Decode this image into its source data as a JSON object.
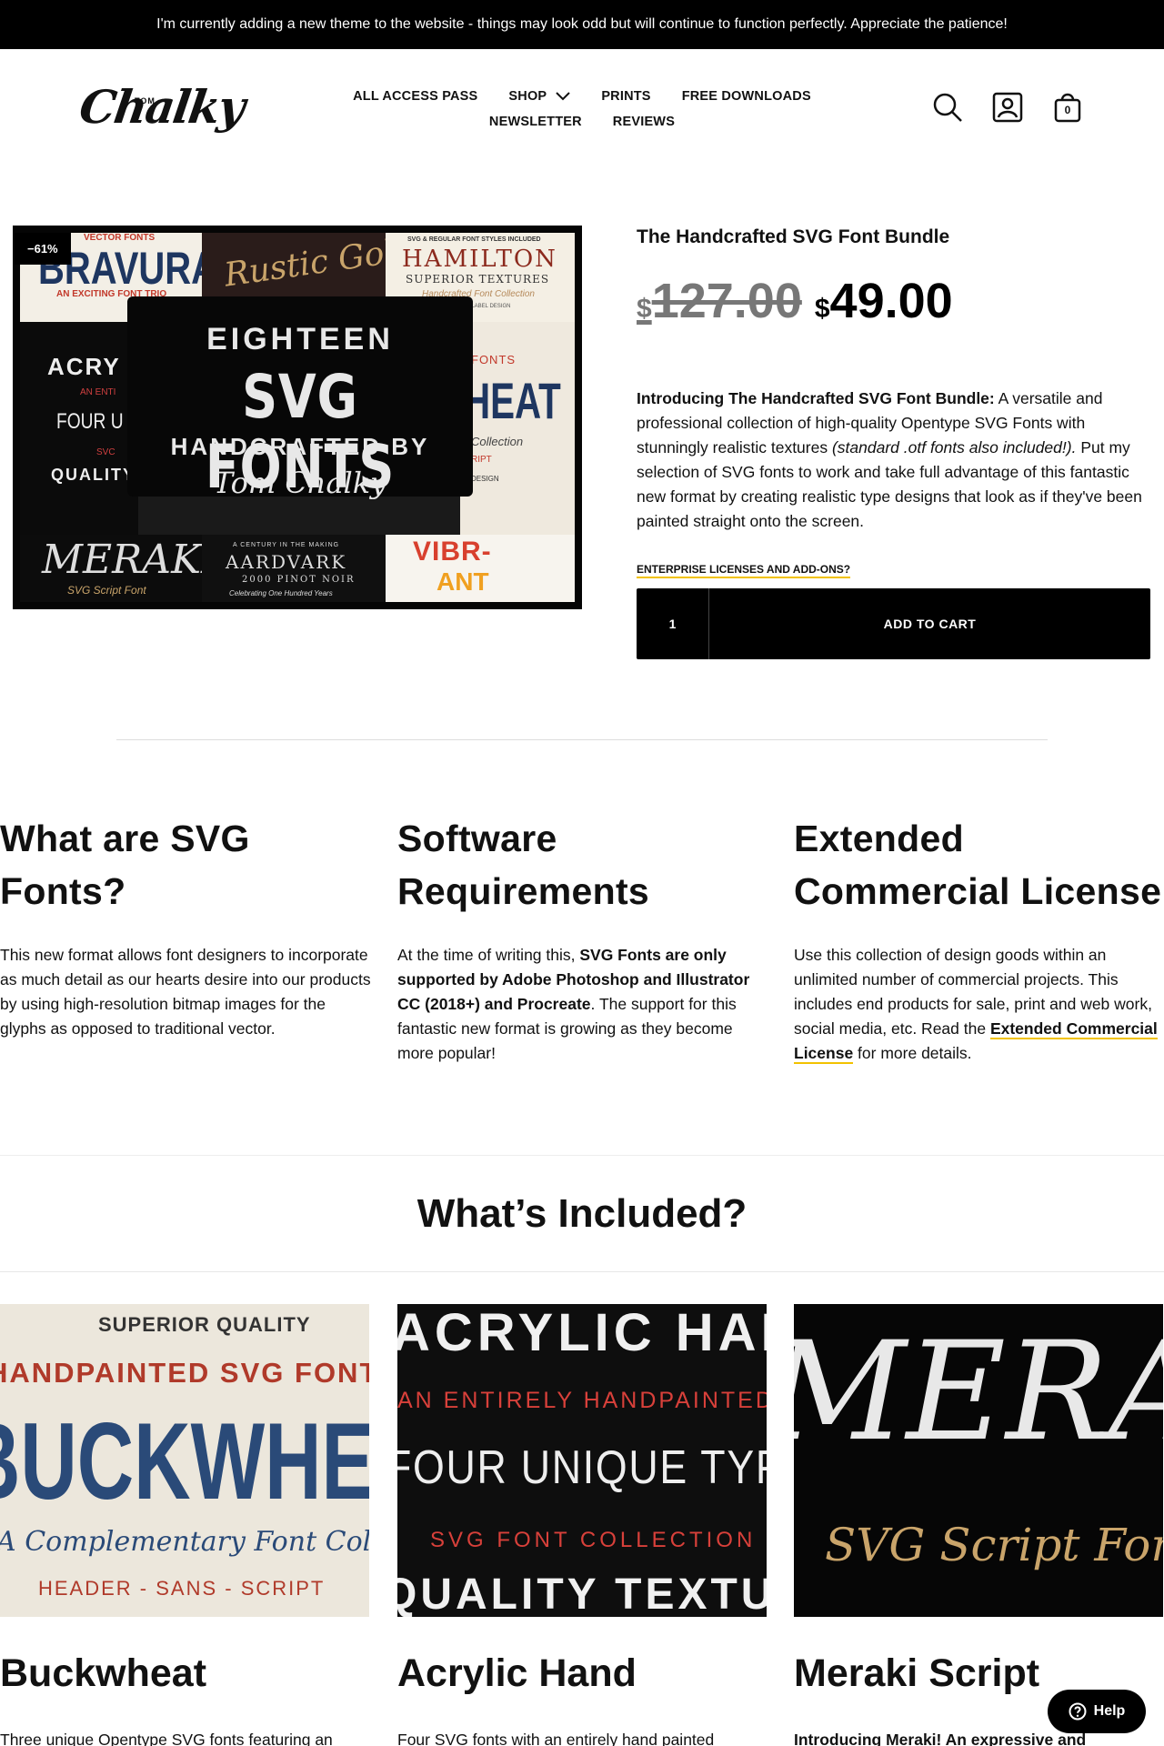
{
  "announcement": "I'm currently adding a new theme to the website - things may look odd but will continue to function perfectly. Appreciate the patience!",
  "logo": {
    "small": "TOM",
    "script": "Chalky"
  },
  "nav": {
    "row1": [
      "ALL ACCESS PASS",
      "SHOP",
      "PRINTS",
      "FREE DOWNLOADS"
    ],
    "row2": [
      "NEWSLETTER",
      "REVIEWS"
    ]
  },
  "header_icons": {
    "search": "search-icon",
    "account": "account-icon",
    "cart": "cart-icon",
    "cart_count": "0"
  },
  "product": {
    "badge": "−61%",
    "image_text": {
      "line1": "EIGHTEEN",
      "line2": "SVG FONTS",
      "line3": "HANDCRAFTED BY",
      "line4": "Tom Chalky",
      "tile_bravura": "BRAVURA",
      "tile_bravura_sub": "AN EXCITING FONT TRIO",
      "tile_bravura_top": "VECTOR FONTS",
      "tile_rustic": "Rustic Gold",
      "tile_hamilton_top": "SVG & REGULAR FONT STYLES INCLUDED",
      "tile_hamilton": "HAMILTON",
      "tile_hamilton_sub": "SUPERIOR TEXTURES",
      "tile_hamilton_script": "Handcrafted Font Collection",
      "tile_hamilton_small": "FOR LABEL DESIGN",
      "tile_acrylic": "ACRY",
      "tile_acrylic_sub": "AN ENTI",
      "tile_four": "FOUR U",
      "tile_svc": "SVC",
      "tile_quality": "QUALITY",
      "tile_fonts": "FONTS",
      "tile_heat": "HEAT",
      "tile_collection": "Collection",
      "tile_ript": "RIPT",
      "tile_design": "DESIGN",
      "tile_meraki": "MERAKI",
      "tile_meraki_sub": "SVG Script Font",
      "tile_aardvark_top": "A CENTURY IN THE MAKING",
      "tile_aardvark": "AARDVARK",
      "tile_aardvark_sub": "2000 PINOT NOIR",
      "tile_aardvark_script": "Celebrating One Hundred Years",
      "tile_vibrant_1": "VIBR-",
      "tile_vibrant_2": "ANT"
    },
    "title": "The Handcrafted SVG Font Bundle",
    "currency": "$",
    "old_price": "127.00",
    "new_price": "49.00",
    "desc_bold": "Introducing The Handcrafted SVG Font Bundle:",
    "desc_1": " A versatile and professional collection of high-quality Opentype SVG Fonts with stunningly realistic textures ",
    "desc_italic": "(standard .otf fonts also included!).",
    "desc_2": " Put my selection of SVG fonts to work and take full advantage of this fantastic new format by creating realistic type designs that look as if they've been painted straight onto the screen.",
    "enterprise_link": "ENTERPRISE LICENSES AND ADD-ONS?",
    "quantity": "1",
    "add_to_cart": "ADD TO CART"
  },
  "info": {
    "col1": {
      "title": "What are SVG Fonts?",
      "text": "This new format allows font designers to incorporate as much detail as our hearts desire into our products by using high-resolution bitmap images for the glyphs as opposed to traditional vector."
    },
    "col2": {
      "title": "Software Requirements",
      "text_1": "At the time of writing this, ",
      "text_bold": "SVG Fonts are only supported by Adobe Photoshop and Illustrator CC (2018+) and Procreate",
      "text_2": ". The support for this fantastic new format is growing as they become more popular!"
    },
    "col3": {
      "title": "Extended Commercial License",
      "text_1": "Use this collection of design goods within an unlimited number of commercial projects. This includes end products for sale, print and web work, social media, etc. Read the ",
      "link": "Extended Commercial License",
      "text_2": " for more details."
    }
  },
  "included_heading": "What’s Included?",
  "cards": [
    {
      "title": "Buckwheat",
      "text": "Three unique Opentype SVG fonts featuring an",
      "img": [
        "SUPERIOR QUALITY",
        "HANDPAINTED SVG FONTS",
        "BUCKWHEAT",
        "A Complementary Font Collection",
        "HEADER - SANS - SCRIPT"
      ]
    },
    {
      "title": "Acrylic Hand",
      "text": "Four SVG fonts with an entirely hand painted",
      "img": [
        "ACRYLIC HAND",
        "AN ENTIRELY HANDPAINTED",
        "FOUR UNIQUE TYPEFACES",
        "SVG FONT COLLECTION",
        "QUALITY TEXTURES"
      ]
    },
    {
      "title": "Meraki Script",
      "text_bold": "Introducing Meraki! An expressive and",
      "img": [
        "MERAKI",
        "SVG Script Font"
      ]
    }
  ],
  "help_label": "Help",
  "colors": {
    "accent_underline": "#f2c200",
    "black": "#000000",
    "muted_price": "#777777"
  }
}
